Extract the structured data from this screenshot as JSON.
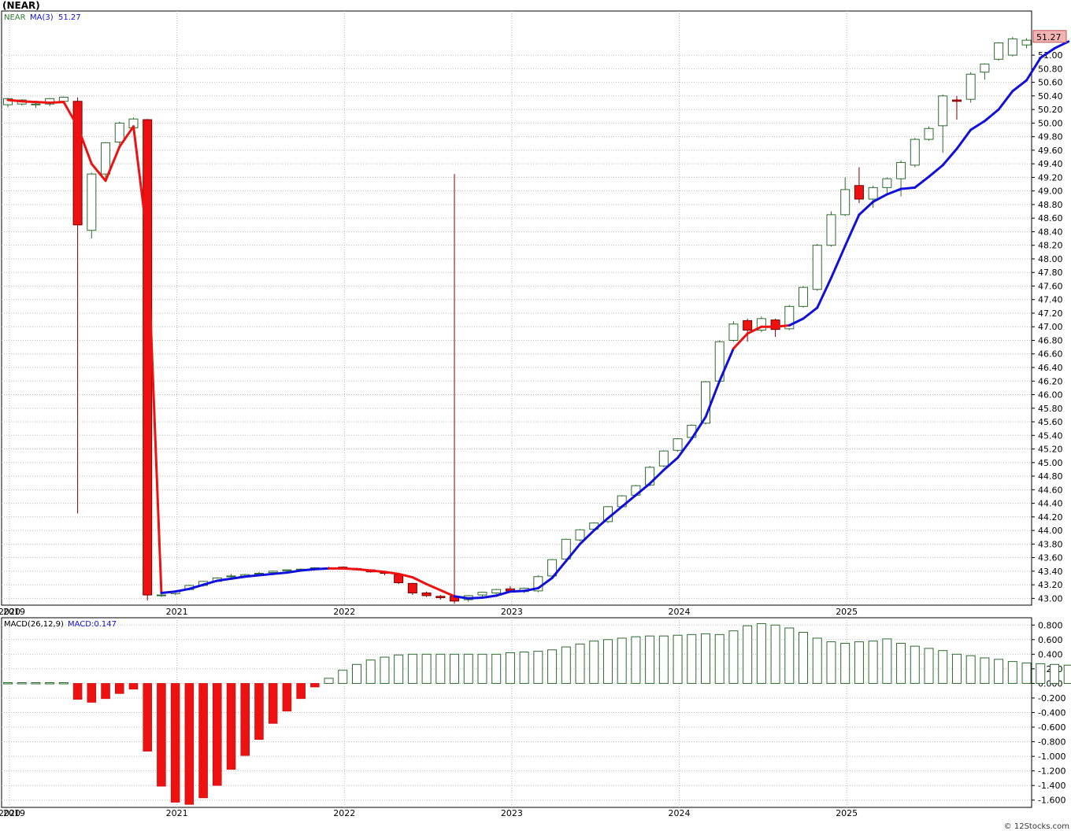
{
  "title": "(NEAR)",
  "watermark": "© 12Stocks.com",
  "price_legend": {
    "symbol": "NEAR",
    "ma_label": "MA(3)",
    "ma_value": "51.27"
  },
  "last_price_tag": "51.27",
  "macd_legend": {
    "label": "MACD(26,12,9)",
    "value_label": "MACD:0.147"
  },
  "colors": {
    "up_fill": "#ffffff",
    "up_stroke": "#2e6b2e",
    "down_fill": "#ee1111",
    "ma_up": "#1010dd",
    "ma_down": "#ee1111",
    "macd_pos": "#2e6b2e",
    "macd_neg": "#ee1111",
    "grid": "#bbbbbb",
    "legend_green": "#2e7d32",
    "legend_blue": "#1010dd",
    "tag_bg": "#f4b4b4"
  },
  "chart_data": [
    {
      "type": "candlestick",
      "name": "price",
      "ylim": [
        42.9,
        51.65
      ],
      "y_ticks": [
        "43.00",
        "43.20",
        "43.40",
        "43.60",
        "43.80",
        "44.00",
        "44.20",
        "44.40",
        "44.60",
        "44.80",
        "45.00",
        "45.20",
        "45.40",
        "45.60",
        "45.80",
        "46.00",
        "46.20",
        "46.40",
        "46.60",
        "46.80",
        "47.00",
        "47.20",
        "47.40",
        "47.60",
        "47.80",
        "48.00",
        "48.20",
        "48.40",
        "48.60",
        "48.80",
        "49.00",
        "49.20",
        "49.40",
        "49.60",
        "49.80",
        "50.00",
        "50.20",
        "50.40",
        "50.60",
        "50.80",
        "51.00"
      ],
      "x_labels": [
        "2019",
        "2020",
        "2021",
        "2022",
        "2023",
        "2024",
        "2025"
      ],
      "x_label_months": [
        -2,
        0,
        12,
        24,
        36,
        48,
        60
      ],
      "start_month": "2019-11",
      "candles": [
        {
          "m": "2019-11",
          "o": 50.27,
          "h": 50.37,
          "l": 50.23,
          "c": 50.36
        },
        {
          "m": "2019-12",
          "o": 50.28,
          "h": 50.35,
          "l": 50.26,
          "c": 50.34
        },
        {
          "m": "2020-01",
          "o": 50.28,
          "h": 50.33,
          "l": 50.22,
          "c": 50.28
        },
        {
          "m": "2020-02",
          "o": 50.28,
          "h": 50.37,
          "l": 50.25,
          "c": 50.36
        },
        {
          "m": "2020-03",
          "o": 50.32,
          "h": 50.39,
          "l": 50.28,
          "c": 50.38
        },
        {
          "m": "2020-04",
          "o": 50.32,
          "h": 50.38,
          "l": 44.25,
          "c": 48.5
        },
        {
          "m": "2020-05",
          "o": 48.42,
          "h": 49.27,
          "l": 48.3,
          "c": 49.25
        },
        {
          "m": "2020-06",
          "o": 49.25,
          "h": 49.72,
          "l": 49.15,
          "c": 49.71
        },
        {
          "m": "2020-07",
          "o": 49.72,
          "h": 50.02,
          "l": 49.68,
          "c": 50.0
        },
        {
          "m": "2020-08",
          "o": 49.93,
          "h": 50.08,
          "l": 49.9,
          "c": 50.06
        },
        {
          "m": "2020-09",
          "o": 50.05,
          "h": 50.06,
          "l": 42.97,
          "c": 43.05
        },
        {
          "m": "2020-10",
          "o": 43.05,
          "h": 43.07,
          "l": 43.02,
          "c": 43.05
        },
        {
          "m": "2020-11",
          "o": 43.07,
          "h": 43.12,
          "l": 43.05,
          "c": 43.1
        },
        {
          "m": "2020-12",
          "o": 43.13,
          "h": 43.2,
          "l": 43.12,
          "c": 43.19
        },
        {
          "m": "2021-01",
          "o": 43.19,
          "h": 43.26,
          "l": 43.17,
          "c": 43.25
        },
        {
          "m": "2021-02",
          "o": 43.25,
          "h": 43.31,
          "l": 43.24,
          "c": 43.3
        },
        {
          "m": "2021-03",
          "o": 43.32,
          "h": 43.36,
          "l": 43.3,
          "c": 43.33
        },
        {
          "m": "2021-04",
          "o": 43.33,
          "h": 43.36,
          "l": 43.32,
          "c": 43.35
        },
        {
          "m": "2021-05",
          "o": 43.36,
          "h": 43.39,
          "l": 43.35,
          "c": 43.37
        },
        {
          "m": "2021-06",
          "o": 43.38,
          "h": 43.41,
          "l": 43.37,
          "c": 43.4
        },
        {
          "m": "2021-07",
          "o": 43.41,
          "h": 43.42,
          "l": 43.4,
          "c": 43.42
        },
        {
          "m": "2021-08",
          "o": 43.42,
          "h": 43.44,
          "l": 43.41,
          "c": 43.43
        },
        {
          "m": "2021-09",
          "o": 43.44,
          "h": 43.46,
          "l": 43.43,
          "c": 43.45
        },
        {
          "m": "2021-10",
          "o": 43.45,
          "h": 43.47,
          "l": 43.44,
          "c": 43.45
        },
        {
          "m": "2021-11",
          "o": 43.46,
          "h": 43.47,
          "l": 43.43,
          "c": 43.44
        },
        {
          "m": "2021-12",
          "o": 43.44,
          "h": 43.45,
          "l": 43.41,
          "c": 43.42
        },
        {
          "m": "2022-01",
          "o": 43.42,
          "h": 43.43,
          "l": 43.38,
          "c": 43.39
        },
        {
          "m": "2022-02",
          "o": 43.38,
          "h": 43.39,
          "l": 43.34,
          "c": 43.37
        },
        {
          "m": "2022-03",
          "o": 43.35,
          "h": 43.36,
          "l": 43.21,
          "c": 43.23
        },
        {
          "m": "2022-04",
          "o": 43.22,
          "h": 43.23,
          "l": 43.05,
          "c": 43.08
        },
        {
          "m": "2022-05",
          "o": 43.08,
          "h": 43.1,
          "l": 43.02,
          "c": 43.04
        },
        {
          "m": "2022-06",
          "o": 43.03,
          "h": 43.05,
          "l": 42.98,
          "c": 43.01
        },
        {
          "m": "2022-07",
          "o": 43.03,
          "h": 49.25,
          "l": 42.92,
          "c": 42.96
        },
        {
          "m": "2022-08",
          "o": 42.98,
          "h": 43.05,
          "l": 42.95,
          "c": 43.04
        },
        {
          "m": "2022-09",
          "o": 43.05,
          "h": 43.1,
          "l": 43.02,
          "c": 43.09
        },
        {
          "m": "2022-10",
          "o": 43.08,
          "h": 43.14,
          "l": 43.06,
          "c": 43.13
        },
        {
          "m": "2022-11",
          "o": 43.14,
          "h": 43.18,
          "l": 43.1,
          "c": 43.11
        },
        {
          "m": "2022-12",
          "o": 43.1,
          "h": 43.16,
          "l": 43.08,
          "c": 43.15
        },
        {
          "m": "2023-01",
          "o": 43.11,
          "h": 43.34,
          "l": 43.09,
          "c": 43.32
        },
        {
          "m": "2023-02",
          "o": 43.33,
          "h": 43.58,
          "l": 43.31,
          "c": 43.57
        },
        {
          "m": "2023-03",
          "o": 43.58,
          "h": 43.88,
          "l": 43.55,
          "c": 43.87
        },
        {
          "m": "2023-04",
          "o": 43.86,
          "h": 44.02,
          "l": 43.84,
          "c": 44.01
        },
        {
          "m": "2023-05",
          "o": 44.02,
          "h": 44.12,
          "l": 44.0,
          "c": 44.11
        },
        {
          "m": "2023-06",
          "o": 44.13,
          "h": 44.36,
          "l": 44.11,
          "c": 44.35
        },
        {
          "m": "2023-07",
          "o": 44.35,
          "h": 44.52,
          "l": 44.33,
          "c": 44.51
        },
        {
          "m": "2023-08",
          "o": 44.52,
          "h": 44.67,
          "l": 44.5,
          "c": 44.66
        },
        {
          "m": "2023-09",
          "o": 44.67,
          "h": 44.95,
          "l": 44.65,
          "c": 44.93
        },
        {
          "m": "2023-10",
          "o": 44.95,
          "h": 45.18,
          "l": 44.93,
          "c": 45.17
        },
        {
          "m": "2023-11",
          "o": 45.18,
          "h": 45.36,
          "l": 45.16,
          "c": 45.35
        },
        {
          "m": "2023-12",
          "o": 45.37,
          "h": 45.56,
          "l": 45.35,
          "c": 45.55
        },
        {
          "m": "2024-01",
          "o": 45.58,
          "h": 46.2,
          "l": 45.56,
          "c": 46.19
        },
        {
          "m": "2024-02",
          "o": 46.2,
          "h": 46.8,
          "l": 46.18,
          "c": 46.78
        },
        {
          "m": "2024-03",
          "o": 46.8,
          "h": 47.08,
          "l": 46.78,
          "c": 47.04
        },
        {
          "m": "2024-04",
          "o": 47.09,
          "h": 47.12,
          "l": 46.78,
          "c": 46.95
        },
        {
          "m": "2024-05",
          "o": 46.95,
          "h": 47.15,
          "l": 46.92,
          "c": 47.12
        },
        {
          "m": "2024-06",
          "o": 47.1,
          "h": 47.12,
          "l": 46.85,
          "c": 46.96
        },
        {
          "m": "2024-07",
          "o": 46.97,
          "h": 47.32,
          "l": 46.95,
          "c": 47.3
        },
        {
          "m": "2024-08",
          "o": 47.3,
          "h": 47.6,
          "l": 47.28,
          "c": 47.58
        },
        {
          "m": "2024-09",
          "o": 47.55,
          "h": 48.22,
          "l": 47.53,
          "c": 48.2
        },
        {
          "m": "2024-10",
          "o": 48.2,
          "h": 48.7,
          "l": 48.18,
          "c": 48.65
        },
        {
          "m": "2024-11",
          "o": 48.65,
          "h": 49.2,
          "l": 48.63,
          "c": 49.02
        },
        {
          "m": "2024-12",
          "o": 49.08,
          "h": 49.35,
          "l": 48.82,
          "c": 48.88
        },
        {
          "m": "2025-01",
          "o": 48.88,
          "h": 49.08,
          "l": 48.75,
          "c": 49.05
        },
        {
          "m": "2025-02",
          "o": 49.05,
          "h": 49.2,
          "l": 48.95,
          "c": 49.18
        },
        {
          "m": "2025-03",
          "o": 49.18,
          "h": 49.45,
          "l": 48.92,
          "c": 49.42
        },
        {
          "m": "2025-04",
          "o": 49.38,
          "h": 49.78,
          "l": 49.35,
          "c": 49.76
        },
        {
          "m": "2025-05",
          "o": 49.76,
          "h": 49.95,
          "l": 49.74,
          "c": 49.92
        },
        {
          "m": "2025-06",
          "o": 49.96,
          "h": 50.42,
          "l": 49.56,
          "c": 50.4
        },
        {
          "m": "2025-07",
          "o": 50.34,
          "h": 50.4,
          "l": 50.05,
          "c": 50.32
        },
        {
          "m": "2025-08",
          "o": 50.35,
          "h": 50.75,
          "l": 50.3,
          "c": 50.72
        },
        {
          "m": "2025-09",
          "o": 50.75,
          "h": 50.88,
          "l": 50.64,
          "c": 50.87
        },
        {
          "m": "2025-10",
          "o": 50.94,
          "h": 51.19,
          "l": 50.92,
          "c": 51.18
        },
        {
          "m": "2025-11",
          "o": 51.0,
          "h": 51.27,
          "l": 50.98,
          "c": 51.24
        },
        {
          "m": "2025-12",
          "o": 51.15,
          "h": 51.25,
          "l": 51.1,
          "c": 51.22
        }
      ],
      "ma": [
        50.34,
        50.32,
        50.31,
        50.3,
        50.31,
        49.95,
        49.4,
        49.15,
        49.65,
        49.95,
        48.3,
        43.08,
        43.1,
        43.14,
        43.2,
        43.26,
        43.29,
        43.32,
        43.34,
        43.36,
        43.38,
        43.41,
        43.43,
        43.44,
        43.44,
        43.43,
        43.41,
        43.39,
        43.36,
        43.31,
        43.21,
        43.12,
        43.03,
        43.0,
        43.01,
        43.04,
        43.1,
        43.11,
        43.15,
        43.3,
        43.55,
        43.8,
        44.0,
        44.18,
        44.35,
        44.52,
        44.69,
        44.89,
        45.07,
        45.35,
        45.67,
        46.2,
        46.68,
        46.9,
        47.0,
        47.0,
        47.02,
        47.12,
        47.28,
        47.72,
        48.19,
        48.65,
        48.84,
        48.95,
        49.03,
        49.05,
        49.21,
        49.38,
        49.62,
        49.9,
        50.03,
        50.2,
        50.47,
        50.63,
        50.96,
        51.1,
        51.2
      ],
      "ma_trend_down_ranges": [
        [
          0,
          11
        ],
        [
          23,
          32
        ],
        [
          52,
          56
        ]
      ]
    },
    {
      "type": "bar",
      "name": "MACD(26,12,9)",
      "ylim": [
        -1.7,
        0.9
      ],
      "y_ticks": [
        "0.800",
        "0.600",
        "0.400",
        "0.200",
        "0.000",
        "-0.200",
        "-0.400",
        "-0.600",
        "-0.800",
        "-1.000",
        "-1.200",
        "-1.400",
        "-1.600"
      ],
      "values": [
        0.01,
        0.01,
        0.01,
        0.01,
        0.01,
        -0.22,
        -0.26,
        -0.21,
        -0.14,
        -0.08,
        -0.93,
        -1.41,
        -1.63,
        -1.66,
        -1.57,
        -1.4,
        -1.18,
        -0.99,
        -0.77,
        -0.55,
        -0.38,
        -0.21,
        -0.05,
        0.07,
        0.18,
        0.26,
        0.32,
        0.36,
        0.39,
        0.4,
        0.4,
        0.4,
        0.4,
        0.4,
        0.4,
        0.4,
        0.42,
        0.43,
        0.44,
        0.46,
        0.5,
        0.54,
        0.58,
        0.6,
        0.62,
        0.64,
        0.65,
        0.65,
        0.66,
        0.67,
        0.68,
        0.67,
        0.72,
        0.79,
        0.82,
        0.8,
        0.76,
        0.7,
        0.62,
        0.57,
        0.55,
        0.57,
        0.58,
        0.61,
        0.55,
        0.51,
        0.48,
        0.45,
        0.4,
        0.38,
        0.35,
        0.33,
        0.3,
        0.28,
        0.27,
        0.26,
        0.25,
        0.22,
        0.15
      ]
    }
  ]
}
